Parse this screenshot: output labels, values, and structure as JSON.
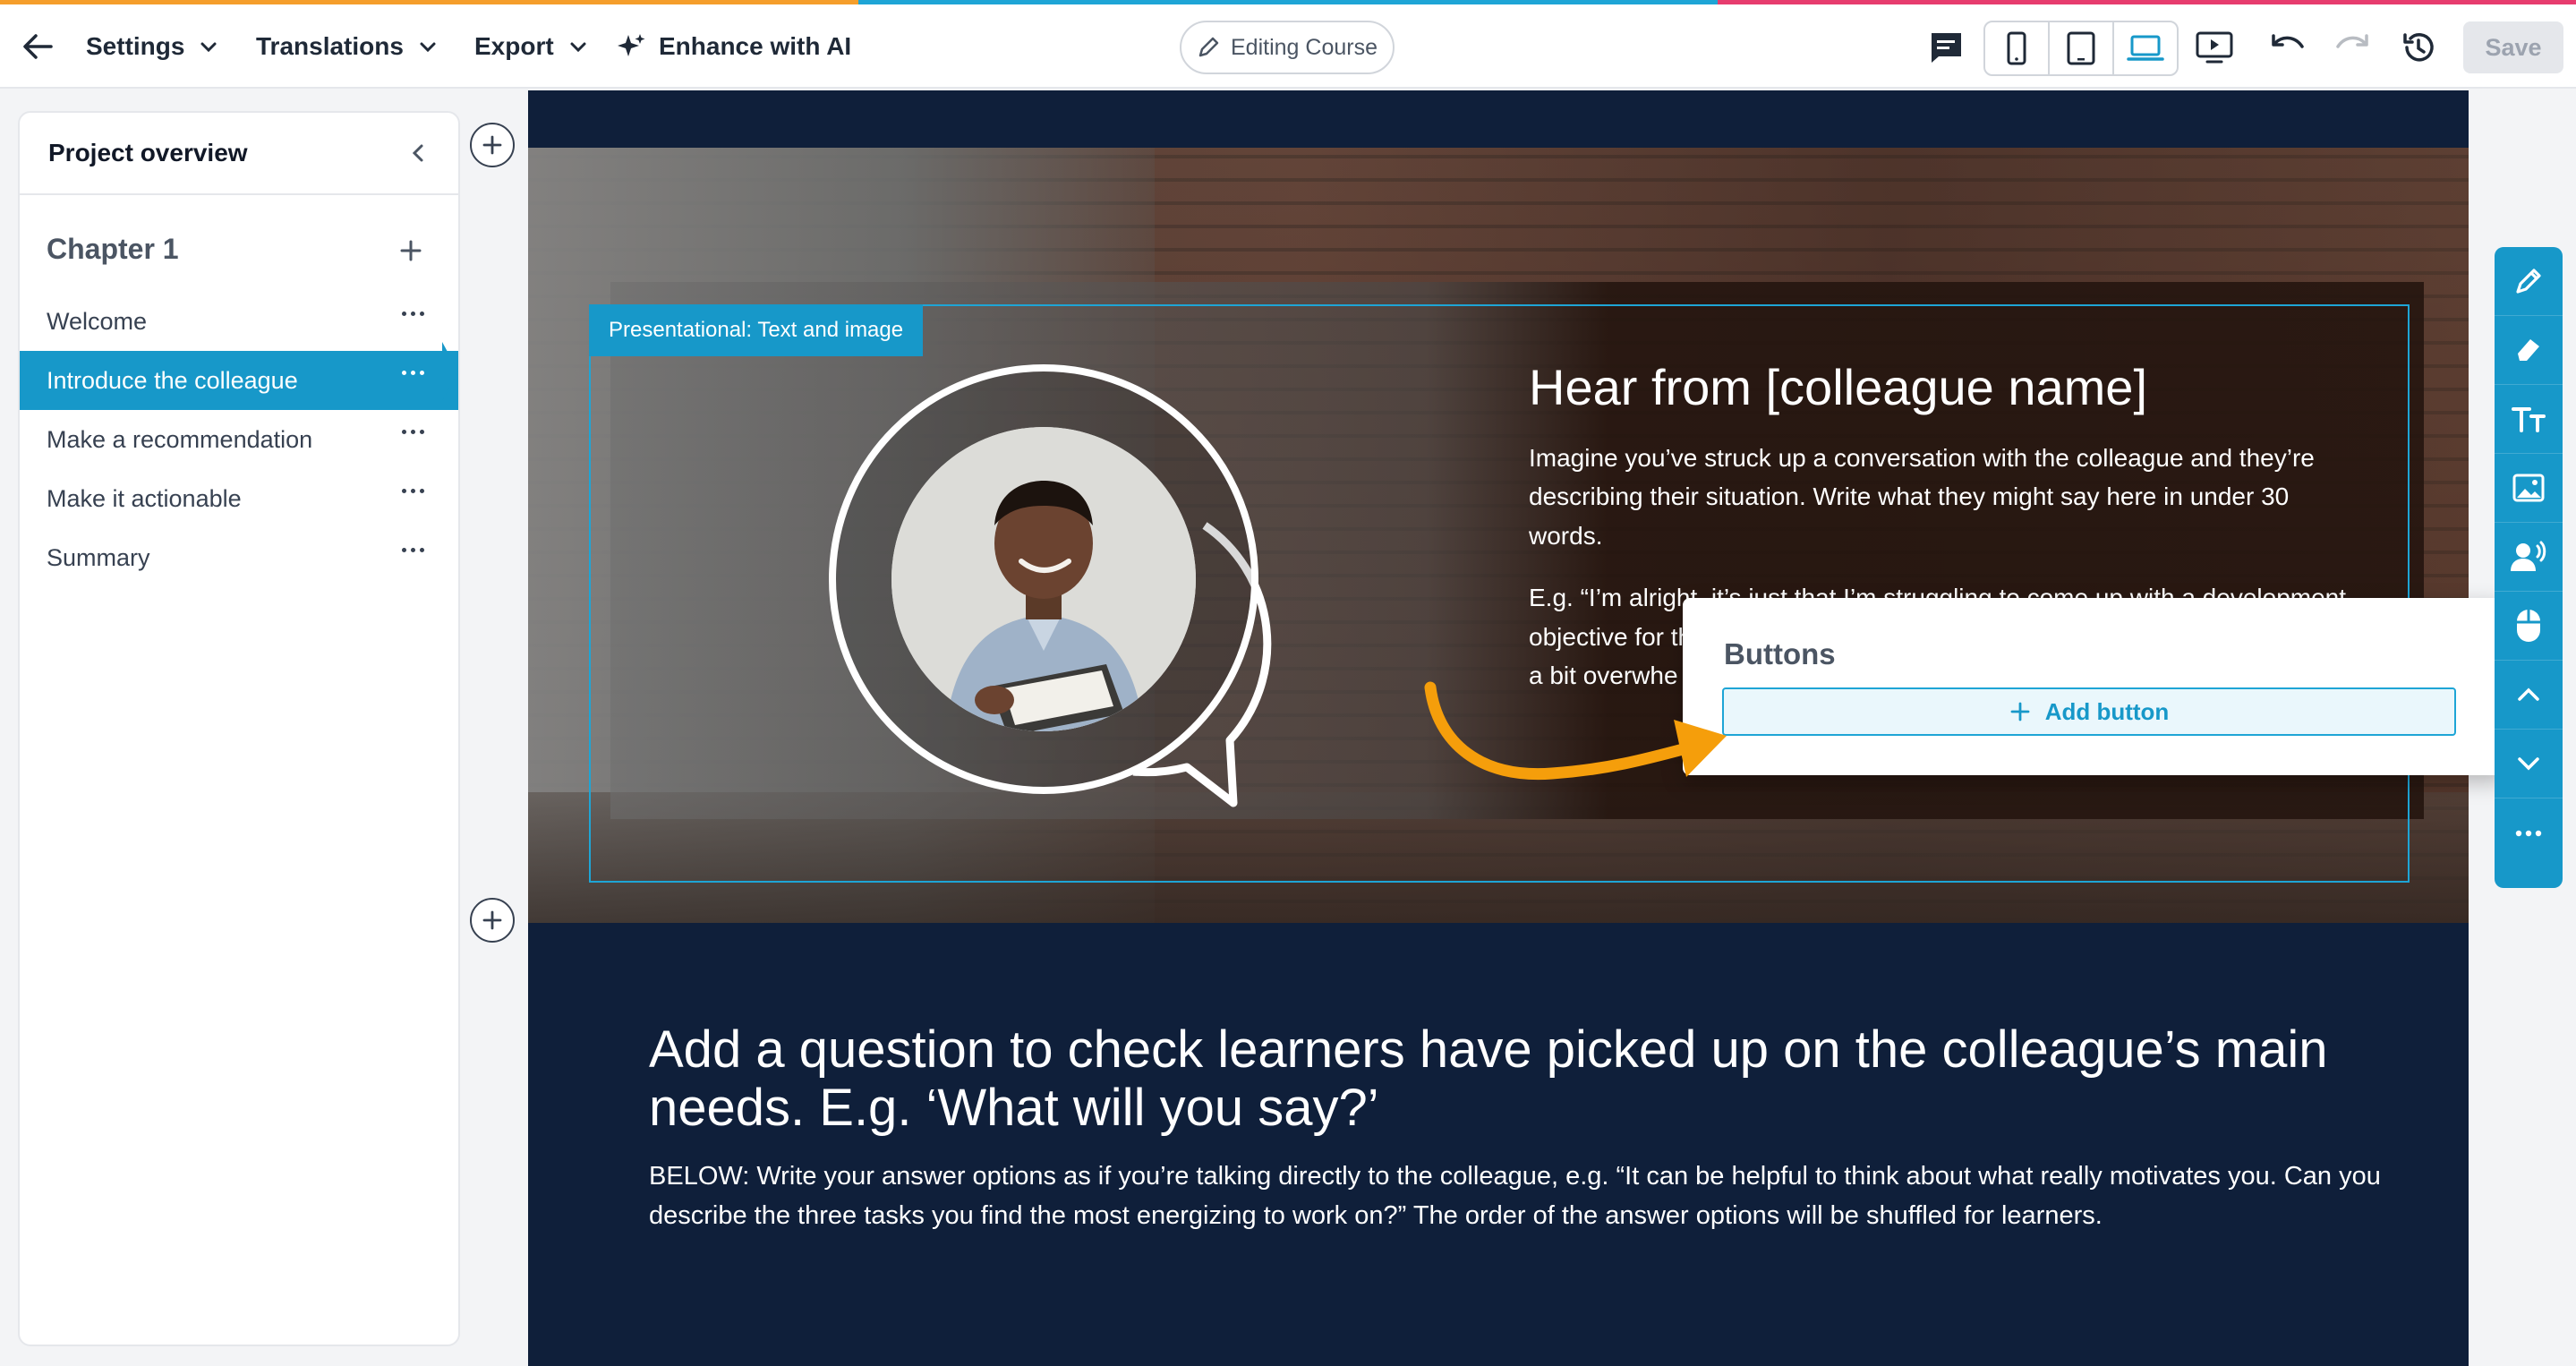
{
  "accent": {
    "orange": "#f59e2b",
    "teal": "#1ea5d6",
    "pink": "#e73c6e",
    "primary": "#1798c9"
  },
  "toolbar": {
    "back_icon": "arrow-left-icon",
    "menus": [
      {
        "label": "Settings"
      },
      {
        "label": "Translations"
      },
      {
        "label": "Export"
      },
      {
        "label": "Enhance with AI"
      }
    ],
    "mode_pill": "Editing Course",
    "icons": [
      "comment-icon",
      "mobile-icon",
      "tablet-icon",
      "laptop-icon",
      "preview-icon",
      "undo-icon",
      "redo-icon",
      "history-icon"
    ],
    "save_label": "Save"
  },
  "sidebar": {
    "title": "Project overview",
    "chapter": "Chapter 1",
    "items": [
      {
        "label": "Welcome",
        "active": false
      },
      {
        "label": "Introduce the colleague",
        "active": true
      },
      {
        "label": "Make a recommendation",
        "active": false
      },
      {
        "label": "Make it actionable",
        "active": false
      },
      {
        "label": "Summary",
        "active": false
      }
    ]
  },
  "hero": {
    "block_tag": "Presentational: Text and image",
    "title": "Hear from [colleague name]",
    "paragraph1": "Imagine you’ve struck up a conversation with the colleague and they’re describing their situation. Write what they might say here in under 30 words.",
    "paragraph2": "E.g. “I’m alright, it’s just that I’m struggling to come up with a development objective for the year, and feeling the pressure to choose a goo",
    "paragraph2_tail": "a bit overwhe"
  },
  "buttons_panel": {
    "title": "Buttons",
    "add_label": "Add button"
  },
  "question": {
    "title": "Add a question to check learners have picked up on the colleague’s main needs. E.g. ‘What will you say?’",
    "body": "BELOW: Write your answer options as if you’re talking directly to the colleague, e.g. “It can be helpful to think about what really motivates you. Can you describe the three tasks you find the most energizing to work on?” The order of the answer options will be shuffled for learners."
  },
  "rail": {
    "icons": [
      "pencil-icon",
      "eraser-icon",
      "text-size-icon",
      "image-icon",
      "voice-icon",
      "mouse-icon",
      "chevron-up-icon",
      "chevron-down-icon",
      "more-icon"
    ]
  }
}
